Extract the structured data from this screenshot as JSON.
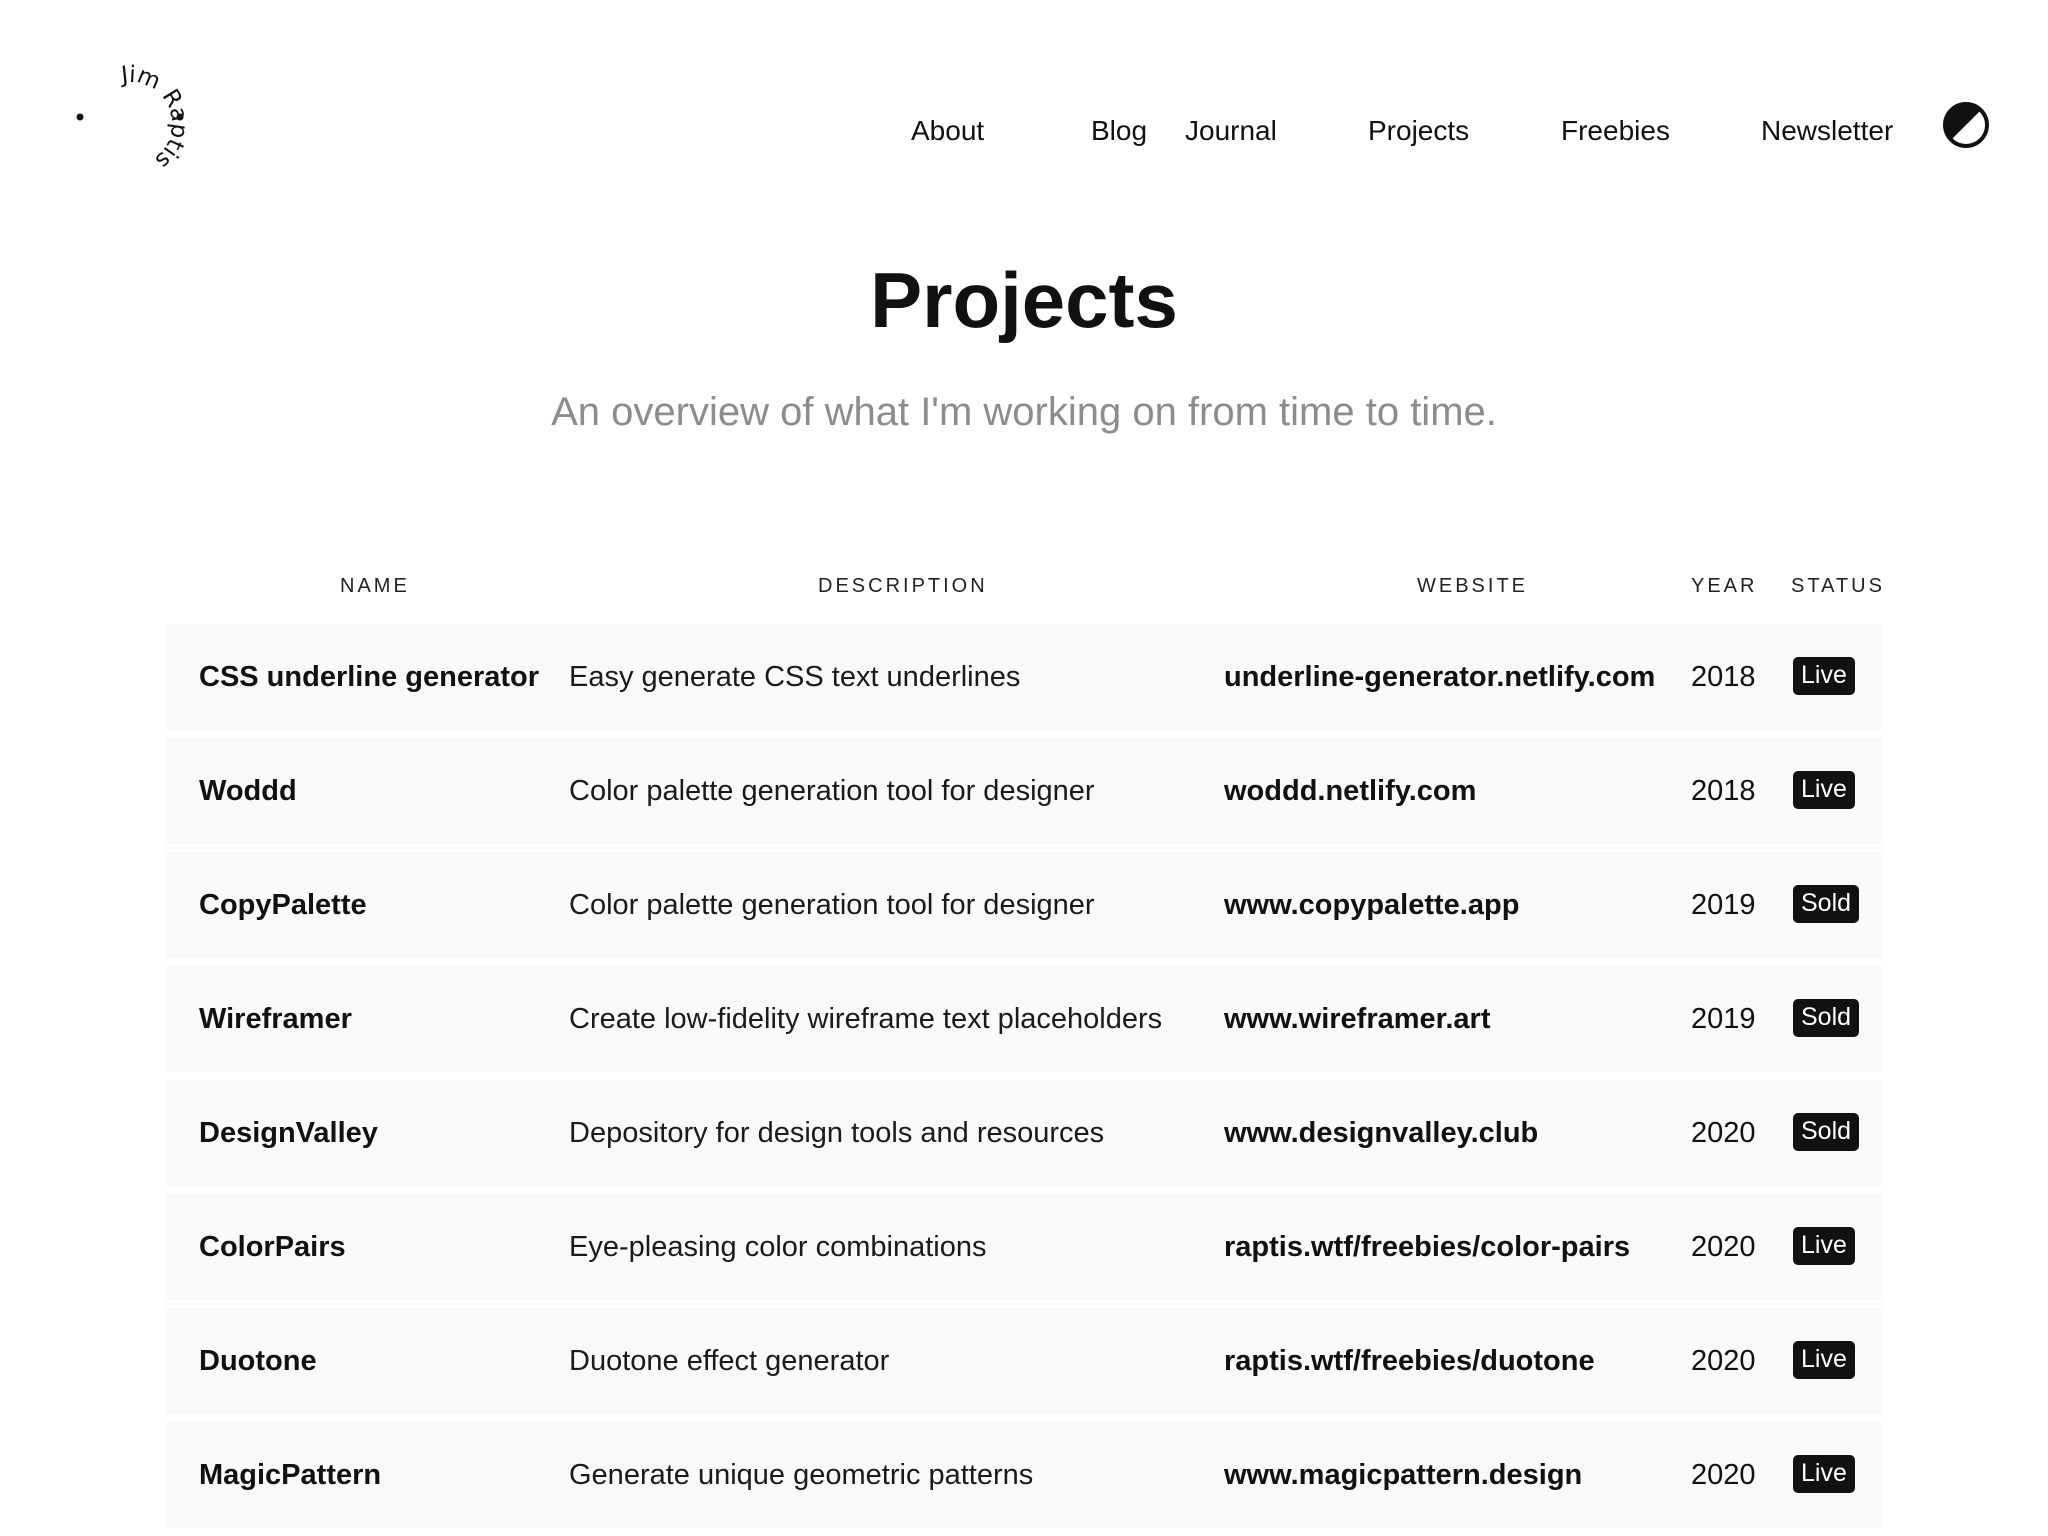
{
  "logo": {
    "text": "Jim Raptis"
  },
  "nav": {
    "items": [
      {
        "label": "About"
      },
      {
        "label": "Blog"
      },
      {
        "label": "Journal"
      },
      {
        "label": "Projects"
      },
      {
        "label": "Freebies"
      },
      {
        "label": "Newsletter"
      }
    ],
    "theme_toggle_icon": "half-circle-contrast-icon"
  },
  "header": {
    "title": "Projects",
    "subtitle": "An overview of what I'm working on from time to time."
  },
  "table": {
    "columns": [
      "NAME",
      "DESCRIPTION",
      "WEBSITE",
      "YEAR",
      "STATUS"
    ],
    "rows": [
      {
        "name": "CSS underline generator",
        "description": "Easy generate CSS text underlines",
        "website": "underline-generator.netlify.com",
        "year": "2018",
        "status": "Live"
      },
      {
        "name": "Woddd",
        "description": "Color palette generation tool for designer",
        "website": "woddd.netlify.com",
        "year": "2018",
        "status": "Live"
      },
      {
        "name": "CopyPalette",
        "description": "Color palette generation tool for designer",
        "website": "www.copypalette.app",
        "year": "2019",
        "status": "Sold"
      },
      {
        "name": "Wireframer",
        "description": "Create low-fidelity wireframe text placeholders",
        "website": "www.wireframer.art",
        "year": "2019",
        "status": "Sold"
      },
      {
        "name": "DesignValley",
        "description": "Depository for design tools and resources",
        "website": "www.designvalley.club",
        "year": "2020",
        "status": "Sold"
      },
      {
        "name": "ColorPairs",
        "description": "Eye-pleasing color combinations",
        "website": "raptis.wtf/freebies/color-pairs",
        "year": "2020",
        "status": "Live"
      },
      {
        "name": "Duotone",
        "description": "Duotone effect generator",
        "website": "raptis.wtf/freebies/duotone",
        "year": "2020",
        "status": "Live"
      },
      {
        "name": "MagicPattern",
        "description": "Generate unique geometric patterns",
        "website": "www.magicpattern.design",
        "year": "2020",
        "status": "Live"
      }
    ]
  },
  "colors": {
    "text": "#111111",
    "subtitle": "#8c8c8c",
    "row_background": "#f9f9f9",
    "badge_background": "#111111",
    "badge_text": "#ffffff"
  }
}
